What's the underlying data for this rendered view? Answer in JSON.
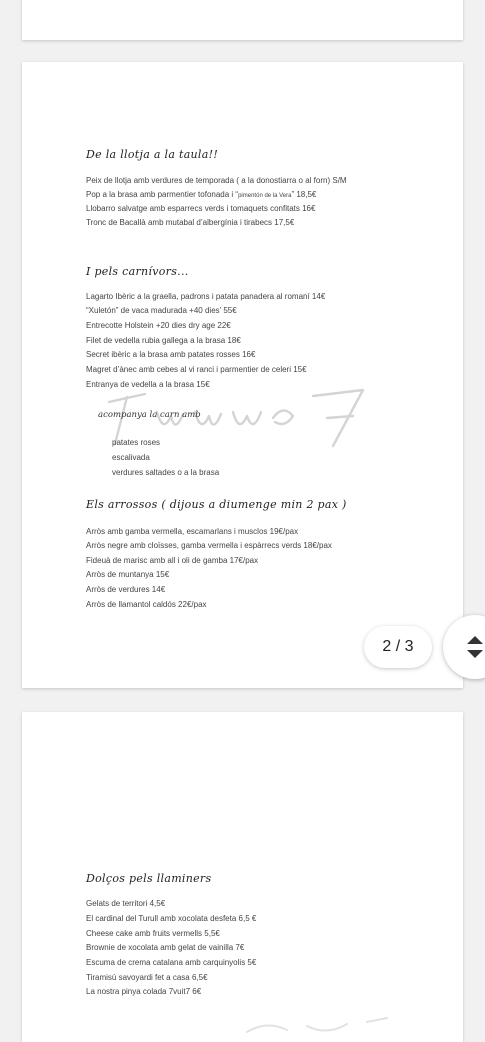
{
  "page_indicator": "2 / 3",
  "section_fish": {
    "title": "De la llotja a la taula!!",
    "items": [
      "Peix de llotja amb verdures  de temporada ( a la donostiarra o al forn)  S/M",
      "Llobarro salvatge amb esparrecs verds i tomaquets confitats 16€",
      "Tronc de Bacallà amb mutabal d’albergínia i tirabecs  17,5€"
    ],
    "pop": {
      "main": "Pop a la brasa amb parmentier tofonada   i “",
      "small": "pimentón de la Vera",
      "tail": "”  18,5€"
    }
  },
  "section_meat": {
    "title": "I pels carnívors...",
    "items": [
      "Lagarto  Ibèric a la graella, padrons  i patata panadera al romaní   14€",
      "“Xuletón” de vaca madurada +40 dies’    55€",
      "Entrecotte Holstein +20 dies dry age   22€",
      "Filet de vedella rubia gallega a la brasa    18€",
      "Secret ibèric a la brasa amb patates rosses    16€",
      "Magret d’ànec amb cebes al vi ranci i parmentier de celeri    15€",
      "Entranya de vedella a la brasa    15€"
    ],
    "accompaniment_title": "acompanya la carn amb",
    "accompaniments": [
      "patates roses",
      "escalivada",
      "verdures saltades o a la brasa"
    ]
  },
  "section_rice": {
    "title": "Els arrossos ( dijous a diumenge min 2 pax )",
    "items": [
      "Arròs  amb gamba vermella, escamarlans  i musclos          19€/pax",
      "Arròs negre  amb cloïsses, gamba vermella i espàrrecs verds      18€/pax",
      "Fideuà de marisc amb all i oli de gamba     17€/pax",
      "Arròs de muntanya    15€",
      "Arròs de verdures    14€",
      "Arròs de llamantol caldós  22€/pax"
    ]
  },
  "section_desserts": {
    "title": "Dolços pels llaminers",
    "items": [
      "Gelats de territori  4,5€",
      "El cardinal del Turull amb xocolata desfeta  6,5 €",
      "Cheese cake amb fruits vermells    5,5€",
      "Brownie de xocolata amb gelat de vainilla 7€",
      "Escuma de crema catalana amb carquinyolis 5€",
      "Tiramisú  savoyardi fet a casa    6,5€",
      "La nostra pinya colada 7vuit7 6€"
    ]
  }
}
